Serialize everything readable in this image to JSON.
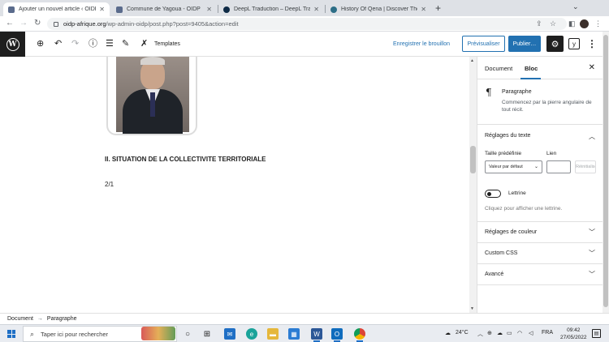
{
  "browser": {
    "tabs": [
      {
        "title": "Ajouter un nouvel article ‹ OIDP",
        "active": true
      },
      {
        "title": "Commune de Yagoua - OIDP",
        "active": false
      },
      {
        "title": "DeepL Traduction – DeepL Transl",
        "active": false
      },
      {
        "title": "History Of Qena | Discover The H",
        "active": false
      }
    ],
    "new_tab": "+",
    "url_domain": "oidp-afrique.org",
    "url_path": "/wp-admin-oidp/post.php?post=9405&action=edit"
  },
  "editor_header": {
    "templates_label": "Templates",
    "save_draft_label": "Enregistrer le brouillon",
    "preview_label": "Prévisualiser",
    "publish_label": "Publier…",
    "yoast_label": "y"
  },
  "content": {
    "heading": "II. SITUATION DE LA COLLECTIVITE TERRITORIALE",
    "paragraph": "2/1"
  },
  "sidebar": {
    "tab_document": "Document",
    "tab_block": "Bloc",
    "block_name": "Paragraphe",
    "block_description": "Commencez par la pierre angulaire de tout récit.",
    "text_settings_title": "Réglages du texte",
    "preset_size_label": "Taille prédéfinie",
    "custom_size_label": "Lien",
    "preset_size_value": "Valeur par défaut",
    "reset_label": "Réinitialiser",
    "dropcap_label": "Lettrine",
    "dropcap_hint": "Cliquez pour afficher une lettrine.",
    "color_settings_title": "Réglages de couleur",
    "custom_css_title": "Custom CSS",
    "advanced_title": "Avancé"
  },
  "breadcrumb": {
    "root": "Document",
    "separator": "→",
    "current": "Paragraphe"
  },
  "taskbar": {
    "search_placeholder": "Taper ici pour rechercher",
    "weather": "24°C",
    "language": "FRA",
    "time": "09:42",
    "date": "27/05/2022"
  },
  "colors": {
    "wp_blue": "#2271b1",
    "wp_dark": "#1e1e1e"
  }
}
